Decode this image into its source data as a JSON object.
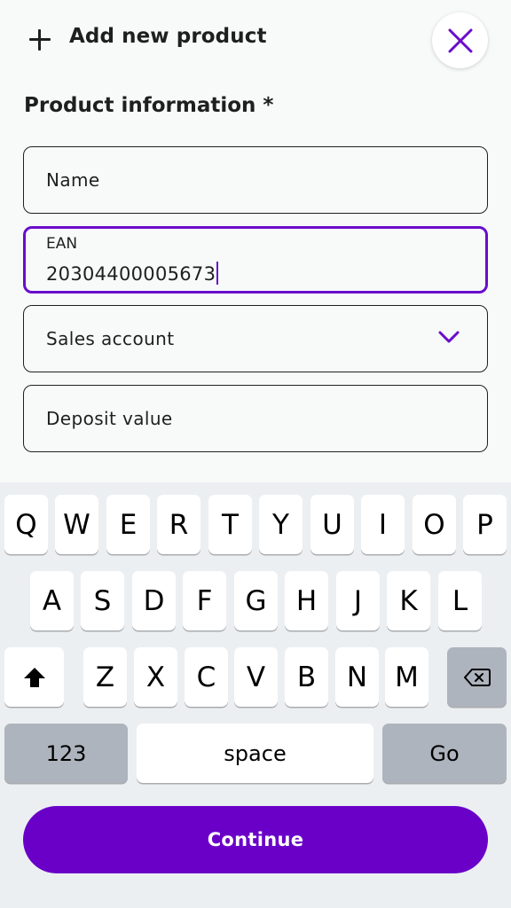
{
  "header": {
    "title": "Add new product",
    "plus_icon": "plus-icon",
    "close_icon": "close-icon"
  },
  "section": {
    "title": "Product information *"
  },
  "form": {
    "name_placeholder": "Name",
    "ean_label": "EAN",
    "ean_value": "20304400005673",
    "sales_account_placeholder": "Sales account",
    "deposit_placeholder": "Deposit value"
  },
  "keyboard": {
    "row1": [
      "Q",
      "W",
      "E",
      "R",
      "T",
      "Y",
      "U",
      "I",
      "O",
      "P"
    ],
    "row2": [
      "A",
      "S",
      "D",
      "F",
      "G",
      "H",
      "J",
      "K",
      "L"
    ],
    "row3": [
      "Z",
      "X",
      "C",
      "V",
      "B",
      "N",
      "M"
    ],
    "numbers_label": "123",
    "space_label": "space",
    "go_label": "Go",
    "shift_icon": "shift-icon",
    "backspace_icon": "backspace-icon"
  },
  "footer": {
    "continue_label": "Continue"
  },
  "colors": {
    "accent": "#6a00c8",
    "background": "#f8fafa",
    "keyboard_bg": "#eceff2",
    "key_dark": "#aeb4bd"
  }
}
